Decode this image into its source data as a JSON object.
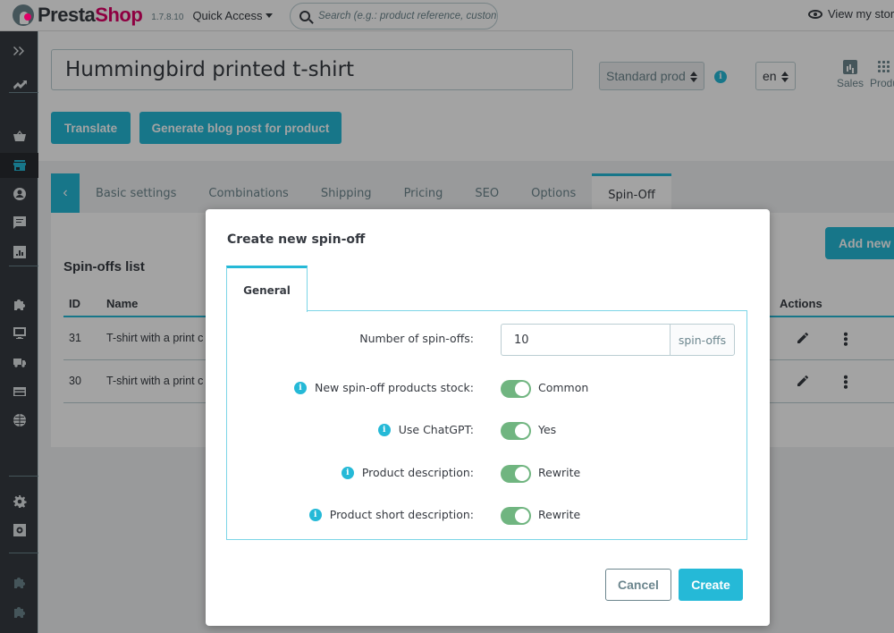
{
  "header": {
    "brand_part1": "Presta",
    "brand_part2": "Shop",
    "version": "1.7.8.10",
    "quick_access": "Quick Access",
    "search_placeholder": "Search (e.g.: product reference, custon",
    "view_store": "View my store"
  },
  "sidebar": {
    "items": [
      {
        "icon": "expand-icon"
      },
      {
        "icon": "trending-up-icon"
      },
      {
        "icon": "basket-icon"
      },
      {
        "icon": "store-icon",
        "active": true
      },
      {
        "icon": "customer-icon"
      },
      {
        "icon": "message-icon"
      },
      {
        "icon": "stats-icon"
      },
      {
        "icon": "puzzle-icon"
      },
      {
        "icon": "monitor-icon"
      },
      {
        "icon": "truck-icon"
      },
      {
        "icon": "credit-card-icon"
      },
      {
        "icon": "globe-icon"
      },
      {
        "icon": "gear-icon"
      },
      {
        "icon": "advanced-settings-icon"
      },
      {
        "icon": "puzzle-icon"
      },
      {
        "icon": "puzzle-icon"
      }
    ]
  },
  "product": {
    "name": "Hummingbird printed t-shirt",
    "translate_label": "Translate",
    "blog_post_label": "Generate blog post for product",
    "type_value": "Standard prod",
    "language_value": "en",
    "sales_label": "Sales",
    "product_label": "Produ"
  },
  "tabs": [
    {
      "label": "Basic settings"
    },
    {
      "label": "Combinations"
    },
    {
      "label": "Shipping"
    },
    {
      "label": "Pricing"
    },
    {
      "label": "SEO"
    },
    {
      "label": "Options"
    },
    {
      "label": "Spin-Off",
      "active": true
    }
  ],
  "spinoffs": {
    "title": "Spin-offs list",
    "add_label": "Add new spin-off",
    "columns": {
      "id": "ID",
      "name": "Name",
      "actions": "Actions"
    },
    "rows": [
      {
        "id": "31",
        "name": "T-shirt with a print c"
      },
      {
        "id": "30",
        "name": "T-shirt with a print c"
      }
    ]
  },
  "modal": {
    "title": "Create new spin-off",
    "tab_label": "General",
    "fields": {
      "count": {
        "label": "Number of spin-offs:",
        "value": "10",
        "addon": "spin-offs"
      },
      "stock": {
        "label": "New spin-off products stock:",
        "value": "Common",
        "on": true
      },
      "chatgpt": {
        "label": "Use ChatGPT:",
        "value": "Yes",
        "on": true
      },
      "description": {
        "label": "Product description:",
        "value": "Rewrite",
        "on": true
      },
      "short_description": {
        "label": "Product short description:",
        "value": "Rewrite",
        "on": true
      }
    },
    "cancel_label": "Cancel",
    "create_label": "Create"
  },
  "colors": {
    "primary": "#25b9d7",
    "sidebar_bg": "#363a41",
    "toggle_on": "#70b580",
    "brand_pink": "#df0067"
  }
}
